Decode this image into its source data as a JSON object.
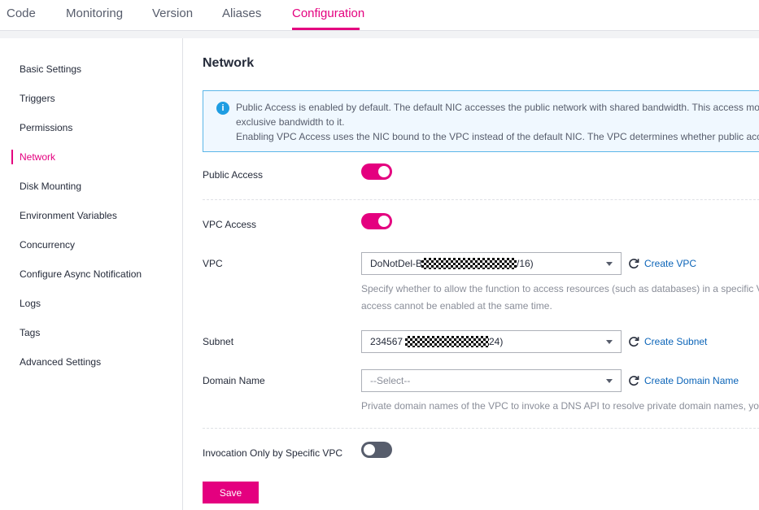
{
  "tabs": [
    {
      "label": "Code"
    },
    {
      "label": "Monitoring"
    },
    {
      "label": "Version"
    },
    {
      "label": "Aliases"
    },
    {
      "label": "Configuration",
      "active": true
    }
  ],
  "sidebar": {
    "items": [
      {
        "label": "Basic Settings"
      },
      {
        "label": "Triggers"
      },
      {
        "label": "Permissions"
      },
      {
        "label": "Network",
        "active": true
      },
      {
        "label": "Disk Mounting"
      },
      {
        "label": "Environment Variables"
      },
      {
        "label": "Concurrency"
      },
      {
        "label": "Configure Async Notification"
      },
      {
        "label": "Logs"
      },
      {
        "label": "Tags"
      },
      {
        "label": "Advanced Settings"
      }
    ]
  },
  "main": {
    "title": "Network",
    "notice": {
      "icon": "info-icon",
      "line1": "Public Access is enabled by default. The default NIC accesses the public network with shared bandwidth. This access mo",
      "line2": "exclusive bandwidth to it.",
      "line3": "Enabling VPC Access uses the NIC bound to the VPC instead of the default NIC. The VPC determines whether public acc"
    },
    "public_access": {
      "label": "Public Access",
      "enabled": true
    },
    "vpc_access": {
      "label": "VPC Access",
      "enabled": true
    },
    "vpc": {
      "label": "VPC",
      "value_prefix": "DoNotDel-B",
      "value_suffix": "/16)",
      "link": "Create VPC",
      "hint1": "Specify whether to allow the function to access resources (such as databases) in a specific V",
      "hint2": "access cannot be enabled at the same time."
    },
    "subnet": {
      "label": "Subnet",
      "value_prefix": "234567",
      "value_suffix": "24)",
      "link": "Create Subnet"
    },
    "domain": {
      "label": "Domain Name",
      "placeholder": "--Select--",
      "link": "Create Domain Name",
      "hint": "Private domain names of the VPC to invoke a DNS API to resolve private domain names, yo"
    },
    "invocation": {
      "label": "Invocation Only by Specific VPC",
      "enabled": false
    },
    "save_label": "Save"
  },
  "colors": {
    "accent": "#e4007f",
    "link": "#0b64b8",
    "info": "#1e9de2"
  }
}
